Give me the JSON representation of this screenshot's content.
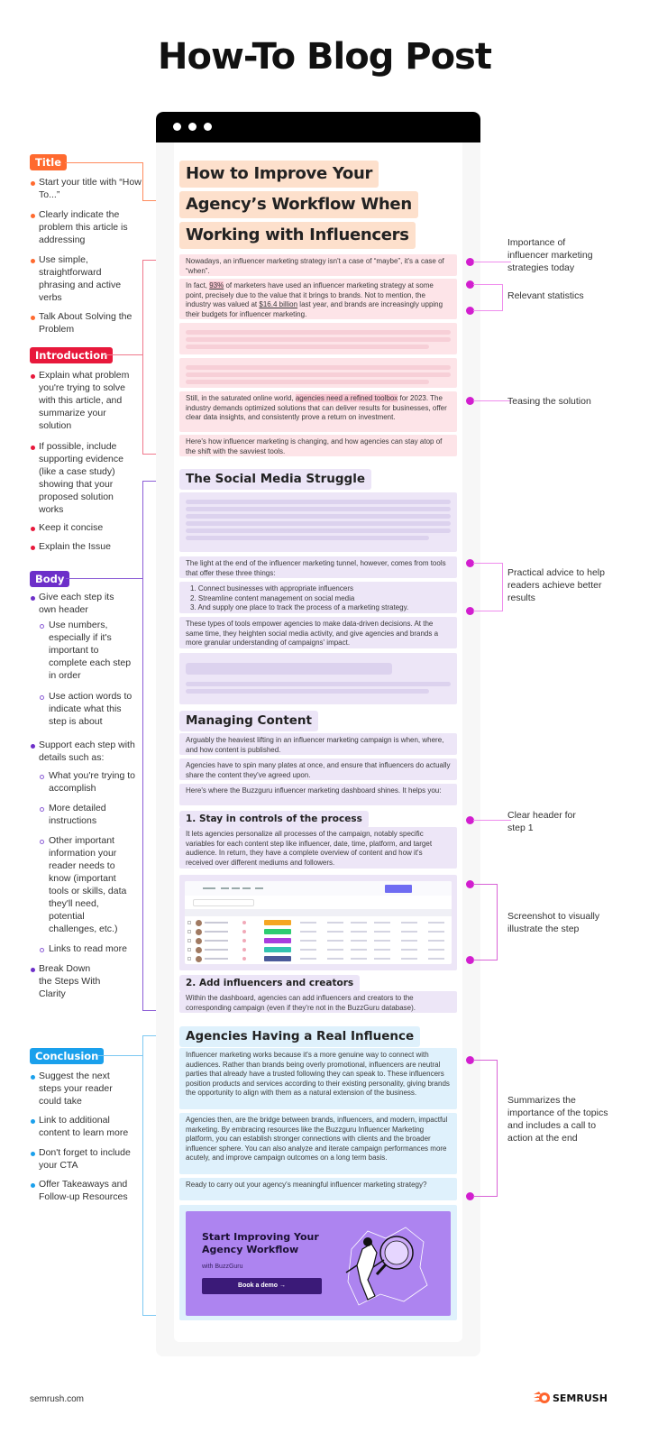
{
  "main_title": "How-To Blog Post",
  "colors": {
    "title": "#ff6a2f",
    "introduction": "#e8183b",
    "body": "#6d2fc9",
    "conclusion": "#1aa0ec",
    "annotation": "#d21ecf"
  },
  "left": {
    "title_section": {
      "tag": "Title",
      "items": [
        "Start your title with “How To...”",
        "Clearly indicate the problem this article is addressing",
        "Use simple, straightforward phrasing and active verbs",
        "Talk About Solving the Problem"
      ]
    },
    "intro_section": {
      "tag": "Introduction",
      "items": [
        "Explain what problem you're trying to solve with this article, and summarize your solution",
        "If possible, include supporting evidence (like a case study) showing that your proposed solution works",
        "Keep it concise",
        "Explain the Issue"
      ]
    },
    "body_section": {
      "tag": "Body",
      "items": [
        {
          "text": "Give each step its own header",
          "sub": [
            "Use numbers, especially if it's important to complete each step in order",
            "Use action words to indicate what this step is about"
          ]
        },
        {
          "text": "Support each step with details such as:",
          "sub": [
            "What you're trying to accomplish",
            "More detailed instructions",
            "Other important information your reader needs to know (important tools or skills, data they'll need, potential challenges, etc.)",
            "Links to read more"
          ]
        },
        {
          "text": "Break Down the Steps With Clarity",
          "sub": []
        }
      ]
    },
    "conclusion_section": {
      "tag": "Conclusion",
      "items": [
        "Suggest the next steps your reader could take",
        "Link to additional content to learn more",
        "Don't forget to include your CTA",
        "Offer Takeaways and Follow-up Resources"
      ]
    }
  },
  "right": {
    "notes": [
      "Importance of influencer marketing strategies today",
      "Relevant statistics",
      "Teasing the solution",
      "Practical advice to help readers achieve better results",
      "Clear header for step 1",
      "Screenshot to visually illustrate the step",
      "Summarizes the importance of the topics and includes a call to action at the end"
    ]
  },
  "article": {
    "title_lines": [
      "How to Improve Your",
      "Agency’s Workflow When",
      "Working with Influencers"
    ],
    "intro": {
      "p1": "Nowadays, an influencer marketing strategy isn't a case of “maybe”, it's a case of “when”.",
      "p2_before": "In fact, ",
      "p2_stat1": "93%",
      "p2_mid": " of marketers have used an influencer marketing strategy at some point, precisely due to the value that it brings to brands. Not to mention, the industry was valued at ",
      "p2_stat2": "$16.4 billion",
      "p2_after": " last year, and brands are increasingly upping their budgets for influencer marketing.",
      "p3_before": "Still, in the saturated online world, ",
      "p3_mark": "agencies need a refined toolbox",
      "p3_after": " for 2023. The industry demands optimized solutions that can deliver results for businesses, offer clear data insights, and consistently prove a return on investment.",
      "p4": "Here's how influencer marketing is changing, and how agencies can stay atop of the shift with the savviest tools."
    },
    "section1": {
      "heading": "The Social Media Struggle",
      "p1": "The light at the end of the influencer marketing tunnel, however, comes from tools that offer these three things:",
      "list": [
        "1. Connect businesses with appropriate influencers",
        "2. Streamline content management on social media",
        "3. And supply one place to track the process of a marketing strategy."
      ],
      "p2": "These types of tools empower agencies to make data-driven decisions. At the same time, they heighten social media activity, and give agencies and brands a more granular understanding of campaigns' impact."
    },
    "section2": {
      "heading": "Managing Content",
      "p1": "Arguably the heaviest lifting in an influencer marketing campaign is when, where, and how content is published.",
      "p2": "Agencies have to spin many plates at once, and ensure that influencers do actually share the content they've agreed upon.",
      "p3": "Here's where the Buzzguru influencer marketing dashboard shines. It helps you:",
      "step1_heading": "1. Stay in controls of the process",
      "step1_text": "It lets agencies personalize all processes of the campaign, notably specific variables for each content step like influencer, date, time, platform, and target audience. In return, they have a complete overview of content and how it's received over different mediums and followers.",
      "step2_heading": "2. Add influencers and creators",
      "step2_text": "Within the dashboard, agencies can add influencers and creators to the corresponding campaign (even if they're not in the BuzzGuru database)."
    },
    "section3": {
      "heading": "Agencies Having a Real Influence",
      "p1": "Influencer marketing works because it's a more genuine way to connect with audiences. Rather than brands being overly promotional, influencers are neutral parties that already have a trusted following they can speak to. These influencers position products and services according to their existing personality, giving brands the opportunity to align with them as a natural extension of the business.",
      "p2": "Agencies then, are the bridge between brands, influencers, and modern, impactful marketing. By embracing resources like the Buzzguru Influencer Marketing platform, you can establish stronger connections with clients and the broader influencer sphere. You can also analyze and iterate campaign performances more acutely, and improve campaign outcomes on a long term basis.",
      "p3": "Ready to carry out your agency's meaningful influencer marketing strategy?"
    },
    "cta": {
      "title": "Start Improving Your Agency Workflow",
      "subtitle": "with BuzzGuru",
      "button": "Book a demo →"
    }
  },
  "footer": {
    "site": "semrush.com",
    "brand": "SEMRUSH"
  }
}
